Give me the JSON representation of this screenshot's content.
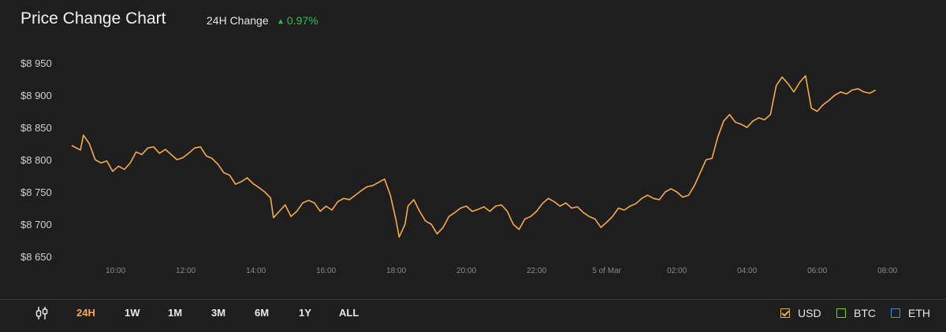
{
  "header": {
    "title": "Price Change Chart",
    "change_label": "24H Change",
    "change_arrow": "▲",
    "change_value": "0.97%"
  },
  "colors": {
    "background": "#1e1e1e",
    "line": "#f7a94d",
    "positive": "#2ebd59",
    "usd": "#f7a94d",
    "btc": "#7ed321",
    "eth": "#4a90e2"
  },
  "toolbar": {
    "icon": "candlestick-range-icon",
    "ranges": [
      "24H",
      "1W",
      "1M",
      "3M",
      "6M",
      "1Y",
      "ALL"
    ],
    "active_range": "24H",
    "currencies": [
      {
        "label": "USD",
        "checked": true
      },
      {
        "label": "BTC",
        "checked": false
      },
      {
        "label": "ETH",
        "checked": false
      }
    ]
  },
  "chart_data": {
    "type": "line",
    "title": "Price Change Chart",
    "xlabel": "",
    "ylabel": "",
    "ylim": [
      8650,
      8950
    ],
    "yticks": [
      8650,
      8700,
      8750,
      8800,
      8850,
      8900,
      8950
    ],
    "ytick_labels": [
      "$8 650",
      "$8 700",
      "$8 750",
      "$8 800",
      "$8 850",
      "$8 900",
      "$8 950"
    ],
    "xlim": [
      "08:45",
      "09:25 (next day)"
    ],
    "xticks": [
      "10:00",
      "12:00",
      "14:00",
      "16:00",
      "18:00",
      "20:00",
      "22:00",
      "5 of Mar",
      "02:00",
      "04:00",
      "06:00",
      "08:00"
    ],
    "grid": false,
    "series": [
      {
        "name": "USD",
        "values": [
          [
            "08:45",
            8822
          ],
          [
            "09:00",
            8815
          ],
          [
            "09:05",
            8838
          ],
          [
            "09:15",
            8825
          ],
          [
            "09:25",
            8800
          ],
          [
            "09:35",
            8795
          ],
          [
            "09:45",
            8798
          ],
          [
            "09:55",
            8782
          ],
          [
            "10:05",
            8790
          ],
          [
            "10:15",
            8785
          ],
          [
            "10:25",
            8795
          ],
          [
            "10:35",
            8812
          ],
          [
            "10:45",
            8808
          ],
          [
            "10:55",
            8818
          ],
          [
            "11:05",
            8820
          ],
          [
            "11:15",
            8810
          ],
          [
            "11:25",
            8816
          ],
          [
            "11:35",
            8808
          ],
          [
            "11:45",
            8800
          ],
          [
            "11:55",
            8803
          ],
          [
            "12:05",
            8810
          ],
          [
            "12:15",
            8818
          ],
          [
            "12:25",
            8820
          ],
          [
            "12:35",
            8806
          ],
          [
            "12:45",
            8802
          ],
          [
            "12:55",
            8793
          ],
          [
            "13:05",
            8780
          ],
          [
            "13:15",
            8776
          ],
          [
            "13:25",
            8762
          ],
          [
            "13:35",
            8766
          ],
          [
            "13:45",
            8772
          ],
          [
            "13:55",
            8763
          ],
          [
            "14:05",
            8757
          ],
          [
            "14:15",
            8750
          ],
          [
            "14:25",
            8741
          ],
          [
            "14:30",
            8710
          ],
          [
            "14:40",
            8720
          ],
          [
            "14:50",
            8730
          ],
          [
            "15:00",
            8712
          ],
          [
            "15:10",
            8720
          ],
          [
            "15:20",
            8733
          ],
          [
            "15:30",
            8737
          ],
          [
            "15:40",
            8733
          ],
          [
            "15:50",
            8720
          ],
          [
            "16:00",
            8728
          ],
          [
            "16:10",
            8722
          ],
          [
            "16:20",
            8735
          ],
          [
            "16:30",
            8740
          ],
          [
            "16:40",
            8738
          ],
          [
            "16:50",
            8745
          ],
          [
            "17:00",
            8752
          ],
          [
            "17:10",
            8758
          ],
          [
            "17:20",
            8760
          ],
          [
            "17:30",
            8765
          ],
          [
            "17:40",
            8770
          ],
          [
            "17:50",
            8745
          ],
          [
            "18:00",
            8705
          ],
          [
            "18:05",
            8680
          ],
          [
            "18:15",
            8700
          ],
          [
            "18:20",
            8728
          ],
          [
            "18:30",
            8738
          ],
          [
            "18:40",
            8720
          ],
          [
            "18:50",
            8705
          ],
          [
            "19:00",
            8700
          ],
          [
            "19:10",
            8685
          ],
          [
            "19:20",
            8695
          ],
          [
            "19:30",
            8712
          ],
          [
            "19:40",
            8718
          ],
          [
            "19:50",
            8725
          ],
          [
            "20:00",
            8728
          ],
          [
            "20:10",
            8720
          ],
          [
            "20:20",
            8723
          ],
          [
            "20:30",
            8727
          ],
          [
            "20:40",
            8720
          ],
          [
            "20:50",
            8728
          ],
          [
            "21:00",
            8730
          ],
          [
            "21:10",
            8720
          ],
          [
            "21:20",
            8700
          ],
          [
            "21:30",
            8692
          ],
          [
            "21:40",
            8708
          ],
          [
            "21:50",
            8712
          ],
          [
            "22:00",
            8720
          ],
          [
            "22:10",
            8732
          ],
          [
            "22:20",
            8740
          ],
          [
            "22:30",
            8735
          ],
          [
            "22:40",
            8728
          ],
          [
            "22:50",
            8733
          ],
          [
            "23:00",
            8725
          ],
          [
            "23:10",
            8727
          ],
          [
            "23:20",
            8718
          ],
          [
            "23:30",
            8712
          ],
          [
            "23:40",
            8708
          ],
          [
            "23:50",
            8695
          ],
          [
            "00:00",
            8703
          ],
          [
            "00:10",
            8712
          ],
          [
            "00:20",
            8725
          ],
          [
            "00:30",
            8722
          ],
          [
            "00:40",
            8728
          ],
          [
            "00:50",
            8732
          ],
          [
            "01:00",
            8740
          ],
          [
            "01:10",
            8745
          ],
          [
            "01:20",
            8740
          ],
          [
            "01:30",
            8738
          ],
          [
            "01:40",
            8750
          ],
          [
            "01:50",
            8755
          ],
          [
            "02:00",
            8750
          ],
          [
            "02:10",
            8742
          ],
          [
            "02:20",
            8745
          ],
          [
            "02:30",
            8760
          ],
          [
            "02:40",
            8780
          ],
          [
            "02:50",
            8800
          ],
          [
            "03:00",
            8802
          ],
          [
            "03:10",
            8835
          ],
          [
            "03:20",
            8860
          ],
          [
            "03:30",
            8870
          ],
          [
            "03:40",
            8858
          ],
          [
            "03:50",
            8855
          ],
          [
            "04:00",
            8850
          ],
          [
            "04:10",
            8860
          ],
          [
            "04:20",
            8865
          ],
          [
            "04:30",
            8862
          ],
          [
            "04:40",
            8870
          ],
          [
            "04:50",
            8915
          ],
          [
            "05:00",
            8928
          ],
          [
            "05:10",
            8918
          ],
          [
            "05:20",
            8905
          ],
          [
            "05:30",
            8920
          ],
          [
            "05:40",
            8930
          ],
          [
            "05:50",
            8880
          ],
          [
            "06:00",
            8875
          ],
          [
            "06:10",
            8885
          ],
          [
            "06:20",
            8892
          ],
          [
            "06:30",
            8900
          ],
          [
            "06:40",
            8905
          ],
          [
            "06:50",
            8902
          ],
          [
            "07:00",
            8908
          ],
          [
            "07:10",
            8910
          ],
          [
            "07:20",
            8905
          ],
          [
            "07:30",
            8903
          ],
          [
            "07:40",
            8908
          ]
        ]
      }
    ]
  }
}
